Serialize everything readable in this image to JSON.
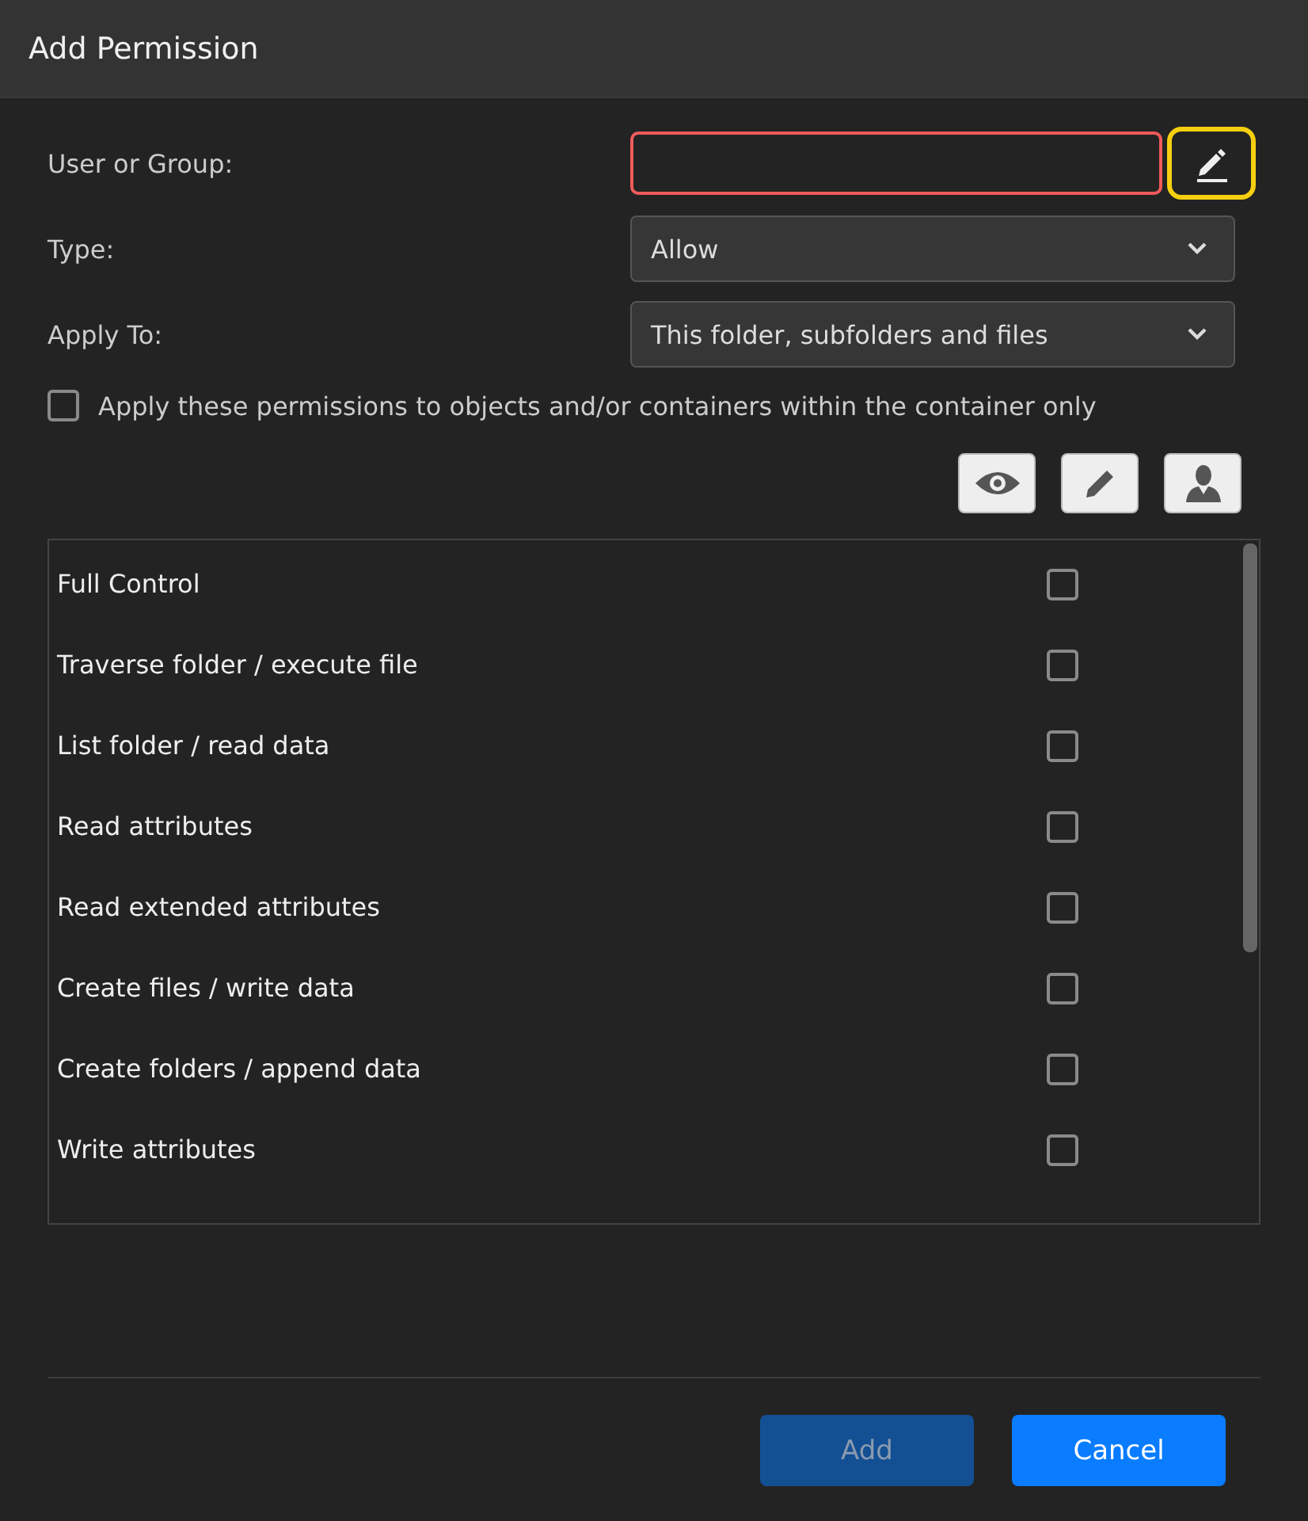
{
  "window": {
    "title": "Add Permission"
  },
  "form": {
    "user_label": "User or Group:",
    "user_field": {
      "invalid": true
    },
    "type_label": "Type:",
    "type_value": "Allow",
    "apply_label": "Apply To:",
    "apply_value": "This folder, subfolders and files",
    "container_only": {
      "label": "Apply these permissions to objects and/or containers within the container only",
      "checked": false
    }
  },
  "permissions": [
    {
      "name": "Full Control",
      "checked": false
    },
    {
      "name": "Traverse folder / execute file",
      "checked": false
    },
    {
      "name": "List folder / read data",
      "checked": false
    },
    {
      "name": "Read attributes",
      "checked": false
    },
    {
      "name": "Read extended attributes",
      "checked": false
    },
    {
      "name": "Create files / write data",
      "checked": false
    },
    {
      "name": "Create folders / append data",
      "checked": false
    },
    {
      "name": "Write attributes",
      "checked": false
    }
  ],
  "buttons": [
    {
      "label": "Add",
      "disabled": true
    },
    {
      "label": "Cancel",
      "disabled": false
    }
  ]
}
